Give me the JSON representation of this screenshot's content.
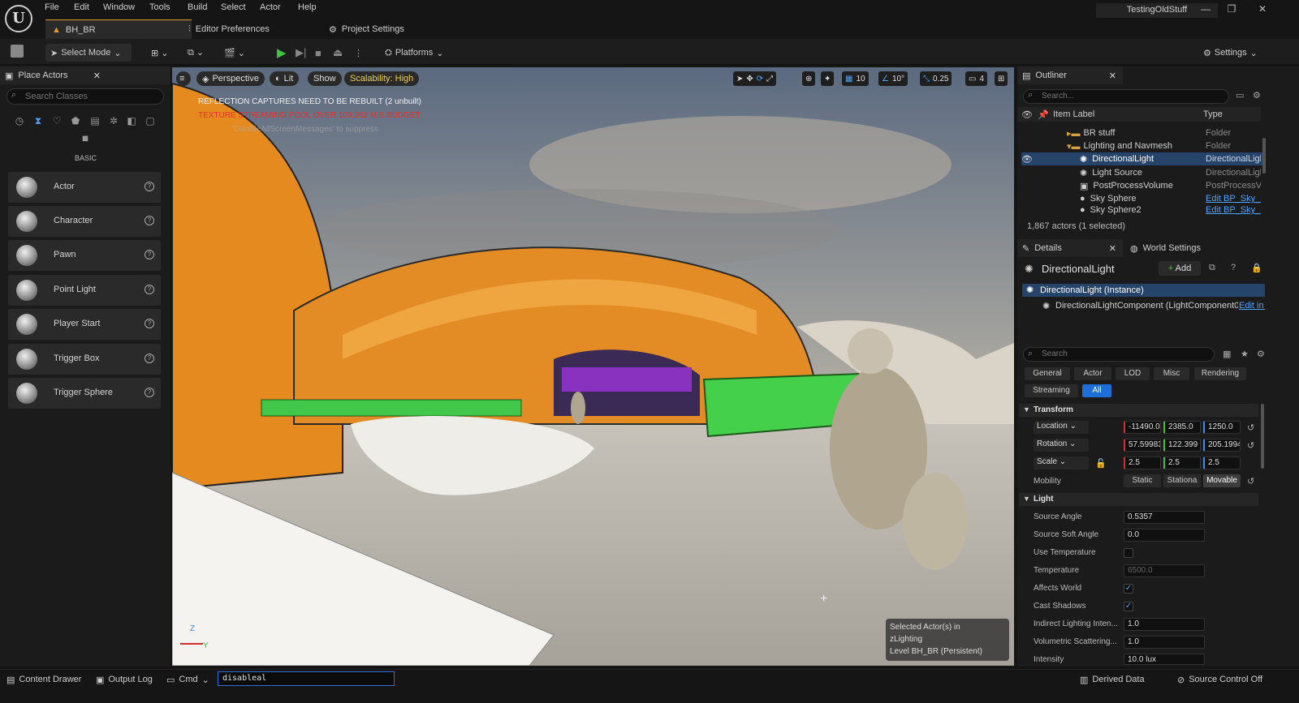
{
  "menu": [
    "File",
    "Edit",
    "Window",
    "Tools",
    "Build",
    "Select",
    "Actor",
    "Help"
  ],
  "project_name": "TestingOldStuff",
  "tabs": {
    "level": "BH_BR",
    "editor_prefs": "Editor Preferences",
    "project_settings": "Project Settings"
  },
  "toolbar": {
    "select_mode": "Select Mode",
    "platforms": "Platforms",
    "settings": "Settings"
  },
  "place_actors": {
    "title": "Place Actors",
    "search_placeholder": "Search Classes",
    "category": "BASIC",
    "items": [
      "Actor",
      "Character",
      "Pawn",
      "Point Light",
      "Player Start",
      "Trigger Box",
      "Trigger Sphere"
    ]
  },
  "viewport": {
    "perspective": "Perspective",
    "lit": "Lit",
    "show": "Show",
    "scalability": "Scalability: High",
    "grid": "10",
    "angle": "10°",
    "scale": "0.25",
    "camera_speed": "4",
    "msg1": "REFLECTION CAPTURES NEED TO BE REBUILT (2 unbuilt)",
    "msg2": "TEXTURE STREAMING POOL OVER 109.262 MiB BUDGET",
    "msg3": "'DisableAllScreenMessages' to suppress",
    "sel1": "Selected Actor(s) in",
    "sel2": "zLighting",
    "sel3": "Level  BH_BR (Persistent)",
    "axis_z": "Z",
    "axis_y": "Y"
  },
  "outliner": {
    "title": "Outliner",
    "search_placeholder": "Search...",
    "col_label": "Item Label",
    "col_type": "Type",
    "rows": [
      {
        "label": "BR stuff",
        "type": "Folder"
      },
      {
        "label": "Lighting and Navmesh",
        "type": "Folder"
      },
      {
        "label": "DirectionalLight",
        "type": "DirectionalLigh"
      },
      {
        "label": "Light Source",
        "type": "DirectionalLigh"
      },
      {
        "label": "PostProcessVolume",
        "type": "PostProcessV"
      },
      {
        "label": "Sky Sphere",
        "type": "Edit BP_Sky_S"
      },
      {
        "label": "Sky Sphere2",
        "type": "Edit BP_Sky_S"
      }
    ],
    "count": "1,867 actors (1 selected)"
  },
  "details": {
    "title": "Details",
    "world_settings": "World Settings",
    "actor_name": "DirectionalLight",
    "add": "Add",
    "instance": "DirectionalLight (Instance)",
    "component": "DirectionalLightComponent (LightComponent0)",
    "edit_in": "Edit in C",
    "search_placeholder": "Search",
    "filters": [
      "General",
      "Actor",
      "LOD",
      "Misc",
      "Rendering",
      "Streaming",
      "All"
    ],
    "transform": "Transform",
    "location": "Location",
    "rotation": "Rotation",
    "scale": "Scale",
    "loc": [
      "-11490.0",
      "2385.0",
      "1250.0"
    ],
    "rot": [
      "57.59983",
      "122.399",
      "205.1994"
    ],
    "scl": [
      "2.5",
      "2.5",
      "2.5"
    ],
    "mobility": "Mobility",
    "mob_opts": [
      "Static",
      "Stationa",
      "Movable"
    ],
    "light": "Light",
    "props": [
      {
        "label": "Source Angle",
        "value": "0.5357"
      },
      {
        "label": "Source Soft Angle",
        "value": "0.0"
      },
      {
        "label": "Use Temperature",
        "value": ""
      },
      {
        "label": "Temperature",
        "value": "6500.0"
      },
      {
        "label": "Affects World",
        "value": ""
      },
      {
        "label": "Cast Shadows",
        "value": ""
      },
      {
        "label": "Indirect Lighting Inten...",
        "value": "1.0"
      },
      {
        "label": "Volumetric Scattering...",
        "value": "1.0"
      },
      {
        "label": "Intensity",
        "value": "10.0 lux"
      }
    ]
  },
  "status": {
    "content_drawer": "Content Drawer",
    "output_log": "Output Log",
    "cmd": "Cmd",
    "cmd_value": "disableal",
    "derived": "Derived Data",
    "source_control": "Source Control Off"
  }
}
